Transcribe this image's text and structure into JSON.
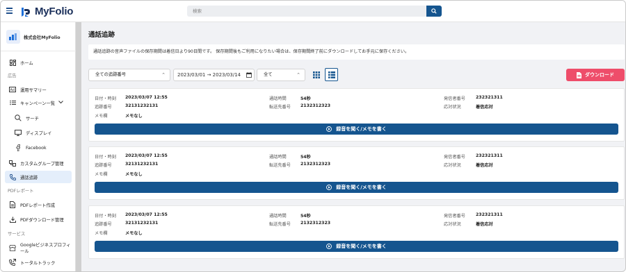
{
  "app": {
    "brand": "MyFolio"
  },
  "search": {
    "placeholder": "検索"
  },
  "sidebar": {
    "company": "株式会社MyFolio",
    "home": "ホーム",
    "section_ads": "広告",
    "ad_summary": "運用サマリー",
    "campaign_list": "キャンペーン一覧",
    "search": "サーチ",
    "display": "ディスプレイ",
    "facebook": "Facebook",
    "custom_group": "カスタムグループ管理",
    "call_tracking": "通話追跡",
    "section_pdf": "PDFレポート",
    "pdf_create": "PDFレポート作成",
    "pdf_download": "PDFダウンロード管理",
    "section_service": "サービス",
    "google_profile": "Googleビジネスプロフィール",
    "total_track": "トータルトラック"
  },
  "main": {
    "title": "通話追跡",
    "notice": "通話追跡の音声ファイルの保存期間は着信日より90日間です。 保存期間後もご利用になりたい場合は、保存期間終了前にダウンロードしてお手元に保存ください。",
    "filter_number": "全ての追跡番号",
    "date_range": "2023/03/01 → 2023/03/14",
    "filter_status": "全て",
    "download": "ダウンロード"
  },
  "labels": {
    "datetime": "日付・時刻",
    "tracking_no": "追跡番号",
    "memo": "メモ欄",
    "duration": "通話時間",
    "forward_to": "転送先番号",
    "caller": "発信者番号",
    "status": "応対状況",
    "play": "録音を聞く/メモを書く"
  },
  "calls": [
    {
      "datetime": "2023/03/07 12:55",
      "tracking_no": "32131232131",
      "memo": "メモなし",
      "duration": "54秒",
      "forward_to": "2132312323",
      "caller": "232321311",
      "status": "着信応対"
    },
    {
      "datetime": "2023/03/07 12:55",
      "tracking_no": "32131232131",
      "memo": "メモなし",
      "duration": "54秒",
      "forward_to": "2132312323",
      "caller": "232321311",
      "status": "着信応対"
    },
    {
      "datetime": "2023/03/07 12:55",
      "tracking_no": "32131232131",
      "memo": "メモなし",
      "duration": "54秒",
      "forward_to": "2132312323",
      "caller": "232321311",
      "status": "着信応対"
    }
  ],
  "colors": {
    "primary": "#15558f",
    "accent": "#ee4d6a",
    "active_bg": "#e4eefb"
  }
}
